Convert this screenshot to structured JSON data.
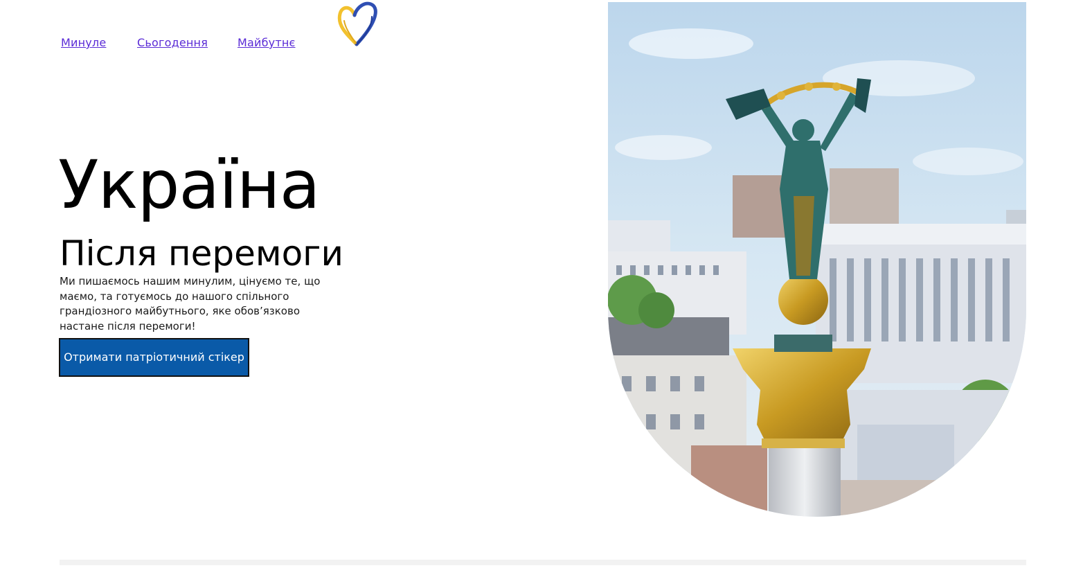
{
  "nav": {
    "links": [
      {
        "label": "Минуле"
      },
      {
        "label": "Сьогодення"
      },
      {
        "label": "Майбутнє"
      }
    ]
  },
  "logo": {
    "icon": "heart-logo-icon",
    "colors": [
      "#2f4fb3",
      "#f2c12e"
    ]
  },
  "hero": {
    "title": "Україна",
    "subtitle": "Після перемоги",
    "text": "Ми пишаємось нашим минулим, цінуємо те, що маємо, та готуємось до нашого спільного грандіозного майбутнього, яке обов’язково настане після перемоги!",
    "cta_label": "Отримати патріотичний стікер"
  },
  "colors": {
    "cta_background": "#0a5aa8",
    "link": "#5a2bd6"
  }
}
